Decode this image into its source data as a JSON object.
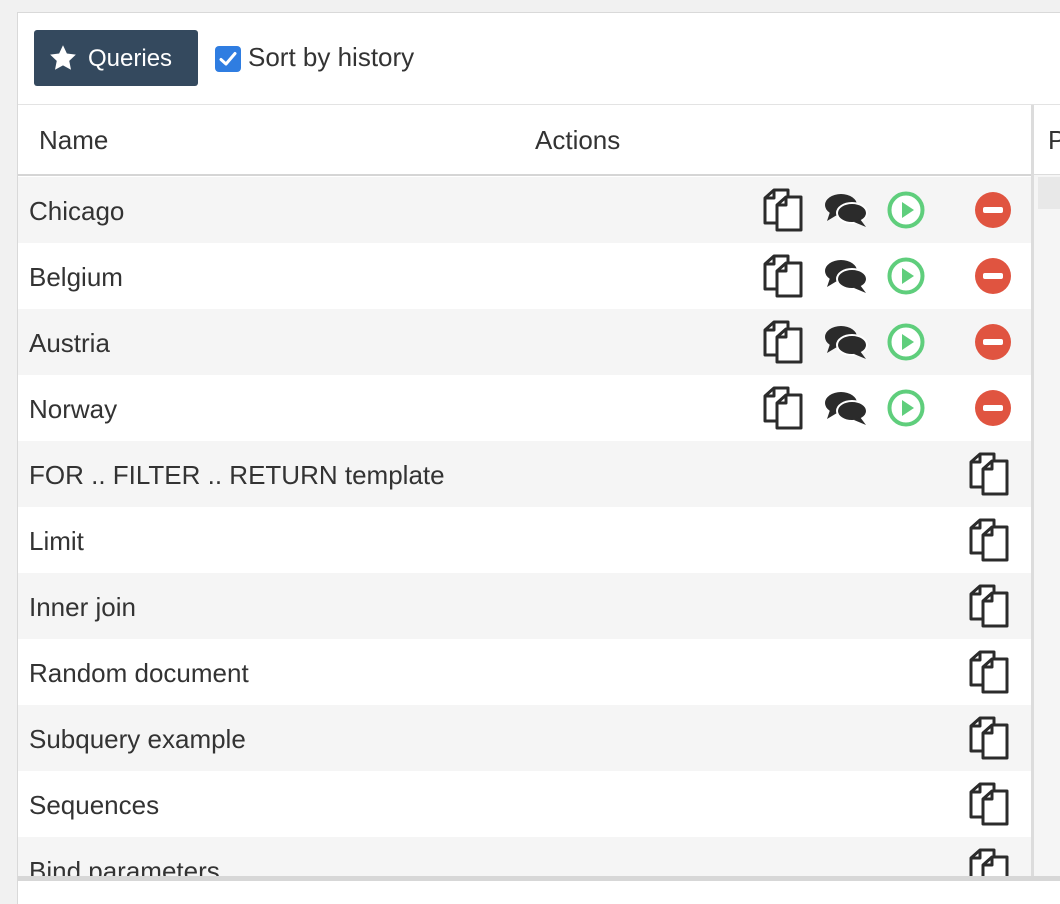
{
  "toolbar": {
    "queries_button_label": "Queries",
    "sort_by_history_label": "Sort by history",
    "sort_by_history_checked": true
  },
  "table": {
    "columns": [
      "Name",
      "Actions"
    ],
    "right_panel_header": "P",
    "rows": [
      {
        "name": "Chicago",
        "type": "user",
        "actions": [
          "copy-icon",
          "comments-icon",
          "play-icon",
          "remove-icon"
        ]
      },
      {
        "name": "Belgium",
        "type": "user",
        "actions": [
          "copy-icon",
          "comments-icon",
          "play-icon",
          "remove-icon"
        ]
      },
      {
        "name": "Austria",
        "type": "user",
        "actions": [
          "copy-icon",
          "comments-icon",
          "play-icon",
          "remove-icon"
        ]
      },
      {
        "name": "Norway",
        "type": "user",
        "actions": [
          "copy-icon",
          "comments-icon",
          "play-icon",
          "remove-icon"
        ]
      },
      {
        "name": "FOR .. FILTER .. RETURN template",
        "type": "example",
        "actions": [
          "copy-icon"
        ]
      },
      {
        "name": "Limit",
        "type": "example",
        "actions": [
          "copy-icon"
        ]
      },
      {
        "name": "Inner join",
        "type": "example",
        "actions": [
          "copy-icon"
        ]
      },
      {
        "name": "Random document",
        "type": "example",
        "actions": [
          "copy-icon"
        ]
      },
      {
        "name": "Subquery example",
        "type": "example",
        "actions": [
          "copy-icon"
        ]
      },
      {
        "name": "Sequences",
        "type": "example",
        "actions": [
          "copy-icon"
        ]
      },
      {
        "name": "Bind parameters",
        "type": "example",
        "actions": [
          "copy-icon"
        ]
      }
    ]
  },
  "colors": {
    "button_bg": "#34495e",
    "checkbox_blue": "#2f7de1",
    "run_green": "#5fce7c",
    "remove_red": "#e05440",
    "icon_dark": "#2b2b2b"
  }
}
